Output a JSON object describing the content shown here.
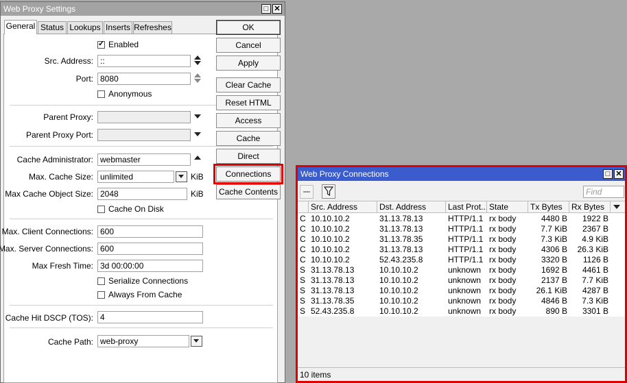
{
  "settings_window": {
    "title": "Web Proxy Settings",
    "tabs": [
      "General",
      "Status",
      "Lookups",
      "Inserts",
      "Refreshes"
    ],
    "enabled_label": "Enabled",
    "enabled": true,
    "src_address": {
      "label": "Src. Address:",
      "value": "::"
    },
    "port": {
      "label": "Port:",
      "value": "8080"
    },
    "anonymous": {
      "label": "Anonymous",
      "checked": false
    },
    "parent_proxy": {
      "label": "Parent Proxy:",
      "value": ""
    },
    "parent_proxy_port": {
      "label": "Parent Proxy Port:",
      "value": ""
    },
    "cache_admin": {
      "label": "Cache Administrator:",
      "value": "webmaster"
    },
    "max_cache_size": {
      "label": "Max. Cache Size:",
      "value": "unlimited",
      "unit": "KiB"
    },
    "max_cache_object_size": {
      "label": "Max Cache Object Size:",
      "value": "2048",
      "unit": "KiB"
    },
    "cache_on_disk": {
      "label": "Cache On Disk",
      "checked": false
    },
    "max_client_connections": {
      "label": "Max. Client Connections:",
      "value": "600"
    },
    "max_server_connections": {
      "label": "Max. Server Connections:",
      "value": "600"
    },
    "max_fresh_time": {
      "label": "Max Fresh Time:",
      "value": "3d 00:00:00"
    },
    "serialize_connections": {
      "label": "Serialize Connections",
      "checked": false
    },
    "always_from_cache": {
      "label": "Always From Cache",
      "checked": false
    },
    "cache_hit_dscp": {
      "label": "Cache Hit DSCP (TOS):",
      "value": "4"
    },
    "cache_path": {
      "label": "Cache Path:",
      "value": "web-proxy"
    },
    "buttons": {
      "ok": "OK",
      "cancel": "Cancel",
      "apply": "Apply",
      "clear_cache": "Clear Cache",
      "reset_html": "Reset HTML",
      "access": "Access",
      "cache": "Cache",
      "direct": "Direct",
      "connections": "Connections",
      "cache_contents": "Cache Contents"
    }
  },
  "connections_window": {
    "title": "Web Proxy Connections",
    "find_placeholder": "Find",
    "columns": [
      "",
      "Src. Address",
      "Dst. Address",
      "Last Prot...",
      "State",
      "Tx Bytes",
      "Rx Bytes"
    ],
    "rows": [
      [
        "C",
        "10.10.10.2",
        "31.13.78.13",
        "HTTP/1.1",
        "rx body",
        "4480 B",
        "1922 B"
      ],
      [
        "C",
        "10.10.10.2",
        "31.13.78.13",
        "HTTP/1.1",
        "rx body",
        "7.7 KiB",
        "2367 B"
      ],
      [
        "C",
        "10.10.10.2",
        "31.13.78.35",
        "HTTP/1.1",
        "rx body",
        "7.3 KiB",
        "4.9 KiB"
      ],
      [
        "C",
        "10.10.10.2",
        "31.13.78.13",
        "HTTP/1.1",
        "rx body",
        "4306 B",
        "26.3 KiB"
      ],
      [
        "C",
        "10.10.10.2",
        "52.43.235.8",
        "HTTP/1.1",
        "rx body",
        "3320 B",
        "1126 B"
      ],
      [
        "S",
        "31.13.78.13",
        "10.10.10.2",
        "unknown",
        "rx body",
        "1692 B",
        "4461 B"
      ],
      [
        "S",
        "31.13.78.13",
        "10.10.10.2",
        "unknown",
        "rx body",
        "2137 B",
        "7.7 KiB"
      ],
      [
        "S",
        "31.13.78.13",
        "10.10.10.2",
        "unknown",
        "rx body",
        "26.1 KiB",
        "4287 B"
      ],
      [
        "S",
        "31.13.78.35",
        "10.10.10.2",
        "unknown",
        "rx body",
        "4846 B",
        "7.3 KiB"
      ],
      [
        "S",
        "52.43.235.8",
        "10.10.10.2",
        "unknown",
        "rx body",
        "890 B",
        "3301 B"
      ]
    ],
    "item_count": "10 items"
  },
  "colors": {
    "title_inactive": "#a3a3a3",
    "title_active": "#3b5ccc",
    "highlight": "#e00000"
  }
}
